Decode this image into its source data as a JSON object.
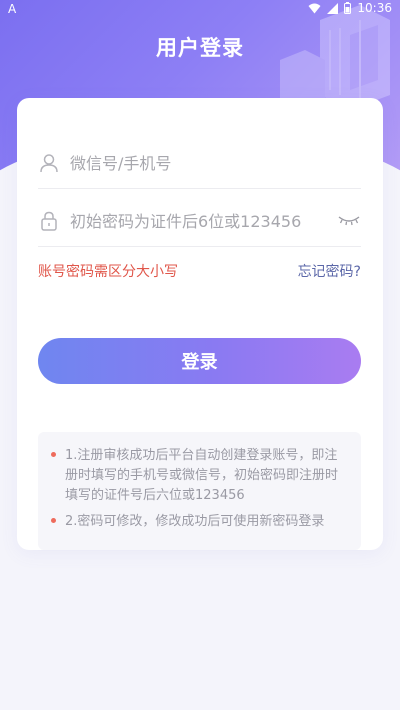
{
  "status_bar": {
    "left_icon": "A",
    "time": "10:36"
  },
  "header": {
    "title": "用户登录"
  },
  "form": {
    "account_placeholder": "微信号/手机号",
    "password_placeholder": "初始密码为证件后6位或123456",
    "case_hint": "账号密码需区分大小写",
    "forgot_password": "忘记密码?",
    "login_label": "登录"
  },
  "notes": [
    "1.注册审核成功后平台自动创建登录账号，即注册时填写的手机号或微信号，初始密码即注册时填写的证件号后六位或123456",
    "2.密码可修改，修改成功后可使用新密码登录"
  ],
  "colors": {
    "hero_gradient_start": "#7b6ff0",
    "hero_gradient_end": "#b39cf6",
    "warning": "#e0564a",
    "link": "#5b67a8",
    "button_start": "#6f86f0",
    "button_end": "#a97cf1"
  }
}
